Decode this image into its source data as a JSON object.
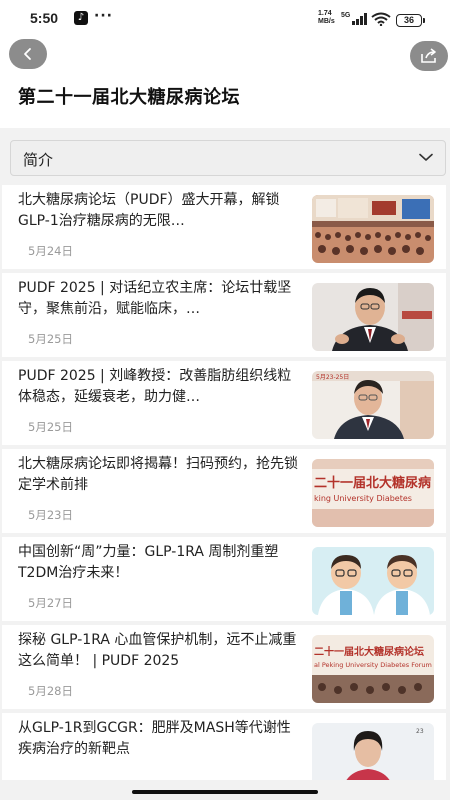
{
  "status_bar": {
    "time": "5:50",
    "app_icon": "tiktok-icon",
    "more": "···",
    "speed_value": "1.74",
    "speed_unit": "MB/s",
    "network": "5G",
    "battery": "36"
  },
  "header": {
    "back_icon": "chevron-left-icon",
    "share_icon": "share-icon",
    "title": "第二十一届北大糖尿病论坛"
  },
  "intro": {
    "label": "简介",
    "chevron_icon": "chevron-down-icon"
  },
  "articles": [
    {
      "title": "北大糖尿病论坛（PUDF）盛大开幕，解锁GLP-1治疗糖尿病的无限…",
      "date": "5月24日",
      "thumb": "conference-hall-image"
    },
    {
      "title": "PUDF 2025 | 对话纪立农主席：论坛廿载坚守，聚焦前沿，赋能临床，…",
      "date": "5月25日",
      "thumb": "speaker-portrait-image"
    },
    {
      "title": "PUDF 2025 | 刘峰教授：改善脂肪组织线粒体稳态，延缓衰老，助力健…",
      "date": "5月25日",
      "thumb": "professor-portrait-image"
    },
    {
      "title": "北大糖尿病论坛即将揭幕！扫码预约，抢先锁定学术前排",
      "date": "5月23日",
      "thumb": "forum-banner-image"
    },
    {
      "title": "中国创新“周”力量：GLP-1RA 周制剂重塑T2DM治疗未来！",
      "date": "5月27日",
      "thumb": "doctors-cartoon-image"
    },
    {
      "title": "探秘 GLP-1RA 心血管保护机制，远不止减重这么简单！ | PUDF 2025",
      "date": "5月28日",
      "thumb": "forum-banner-image-2"
    },
    {
      "title": "从GLP-1R到GCGR：肥胖及MASH等代谢性疾病治疗的新靶点",
      "date": "",
      "thumb": "doctor-portrait-image"
    }
  ],
  "thumb_texts": {
    "banner_cn": "二十一届北大糖尿病",
    "banner_en": "king University Diabetes",
    "banner2_cn": "二十一届北大糖尿病论坛",
    "banner2_en": "al Peking University Diabetes Forum",
    "speaker_badge": "5月23-25日",
    "doctor_tag": "23"
  },
  "colors": {
    "background": "#f2f2f2",
    "card": "#ffffff",
    "nav_button": "#8c8c8c",
    "banner_red": "#b3322a"
  }
}
